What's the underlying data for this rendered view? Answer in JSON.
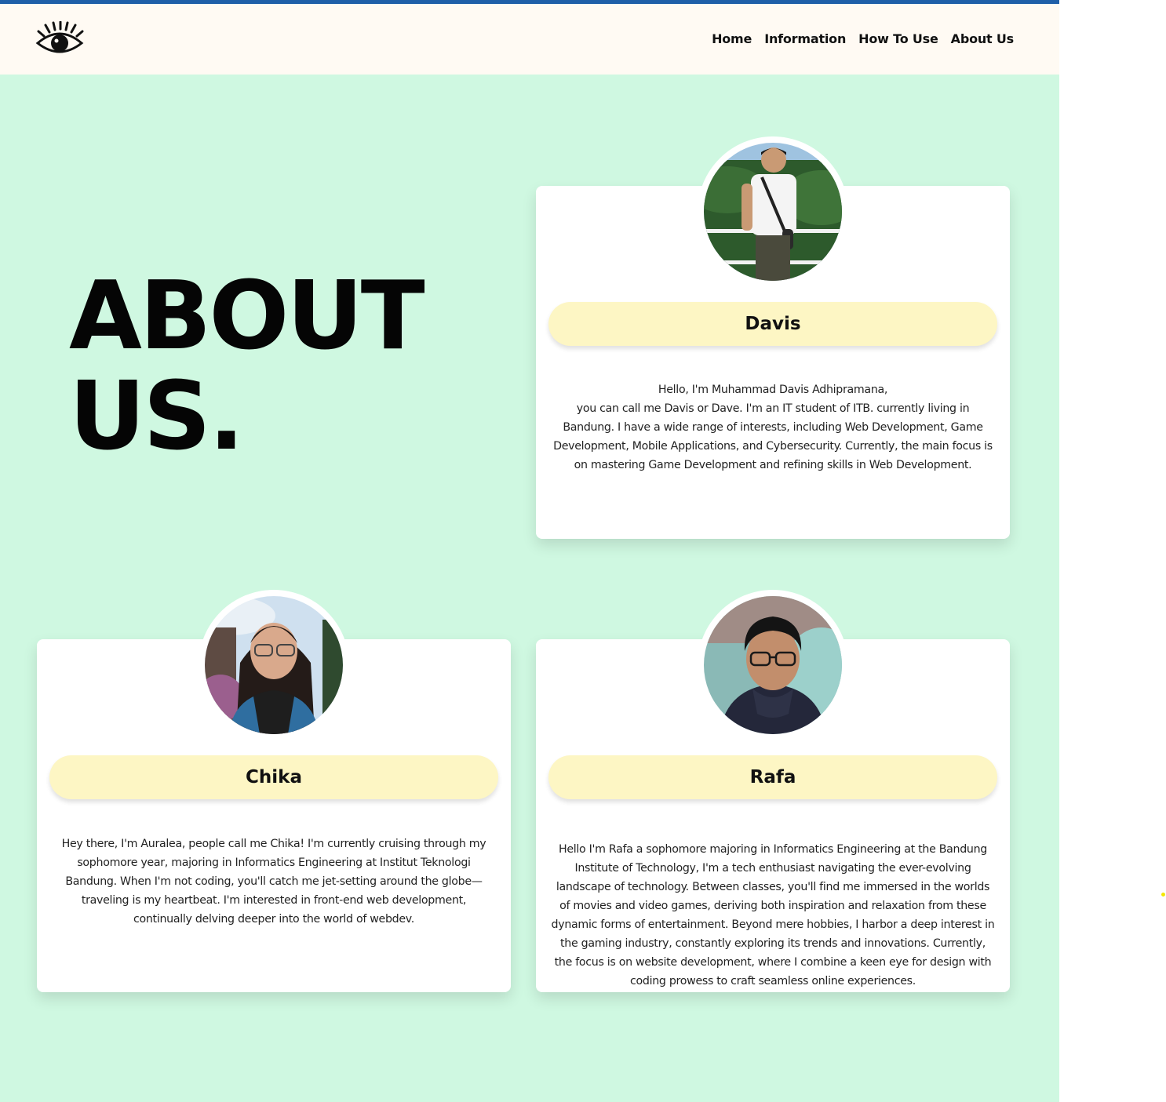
{
  "nav": {
    "logo_icon": "eye-icon",
    "items": [
      {
        "label": "Home"
      },
      {
        "label": "Information"
      },
      {
        "label": "How To Use"
      },
      {
        "label": "About Us"
      }
    ]
  },
  "hero": {
    "line1": "ABOUT",
    "line2": "US."
  },
  "members": [
    {
      "name": "Davis",
      "photo_icon": "portrait-photo",
      "bio_line1": "Hello, I'm Muhammad Davis Adhipramana,",
      "bio_rest": "you can call me Davis or Dave. I'm an IT student of ITB. currently living in Bandung. I have a wide range of interests, including Web Development, Game Development, Mobile Applications, and Cybersecurity. Currently, the main focus is on mastering Game Development and refining skills in Web Development."
    },
    {
      "name": "Chika",
      "photo_icon": "portrait-photo",
      "bio": "Hey there, I'm Auralea, people call me Chika! I'm currently cruising through my sophomore year, majoring in Informatics Engineering at Institut Teknologi Bandung. When I'm not coding, you'll catch me jet-setting around the globe—traveling is my heartbeat. I'm interested in front-end web development, continually delving deeper into the world of webdev."
    },
    {
      "name": "Rafa",
      "photo_icon": "portrait-photo",
      "bio": "Hello I'm Rafa a sophomore majoring in Informatics Engineering at the Bandung Institute of Technology, I'm a tech enthusiast navigating the ever-evolving landscape of technology. Between classes, you'll find me immersed in the worlds of movies and video games, deriving both inspiration and relaxation from these dynamic forms of entertainment. Beyond mere hobbies, I harbor a deep interest in the gaming industry, constantly exploring its trends and innovations. Currently, the focus is on website development, where I combine a keen eye for design with coding prowess to craft seamless online experiences."
    }
  ],
  "colors": {
    "background": "#cff8e1",
    "navbar": "#fffaf3",
    "accent_line": "#1f5fa8",
    "name_pill": "#fdf6c4",
    "card": "#ffffff"
  }
}
